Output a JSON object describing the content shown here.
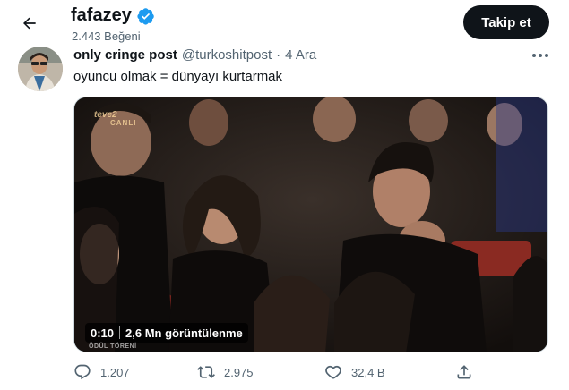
{
  "header": {
    "profile_name": "fafazey",
    "likes_label": "2.443 Beğeni",
    "follow_label": "Takip et"
  },
  "post": {
    "author": "only cringe post",
    "handle": "@turkoshitpost",
    "separator": "·",
    "date": "4 Ara",
    "text": "oyuncu olmak = dünyayı kurtarmak"
  },
  "media": {
    "channel_logo": "teve2",
    "channel_sub": "CANLI",
    "award_tag": "ÖDÜL TÖRENİ",
    "duration": "0:10",
    "views": "2,6 Mn görüntülenme"
  },
  "actions": {
    "replies": "1.207",
    "retweets": "2.975",
    "likes": "32,4 B"
  },
  "colors": {
    "text_primary": "#0f1419",
    "text_secondary": "#536471",
    "verified_blue": "#1d9bf0",
    "button_bg": "#0f1419"
  }
}
